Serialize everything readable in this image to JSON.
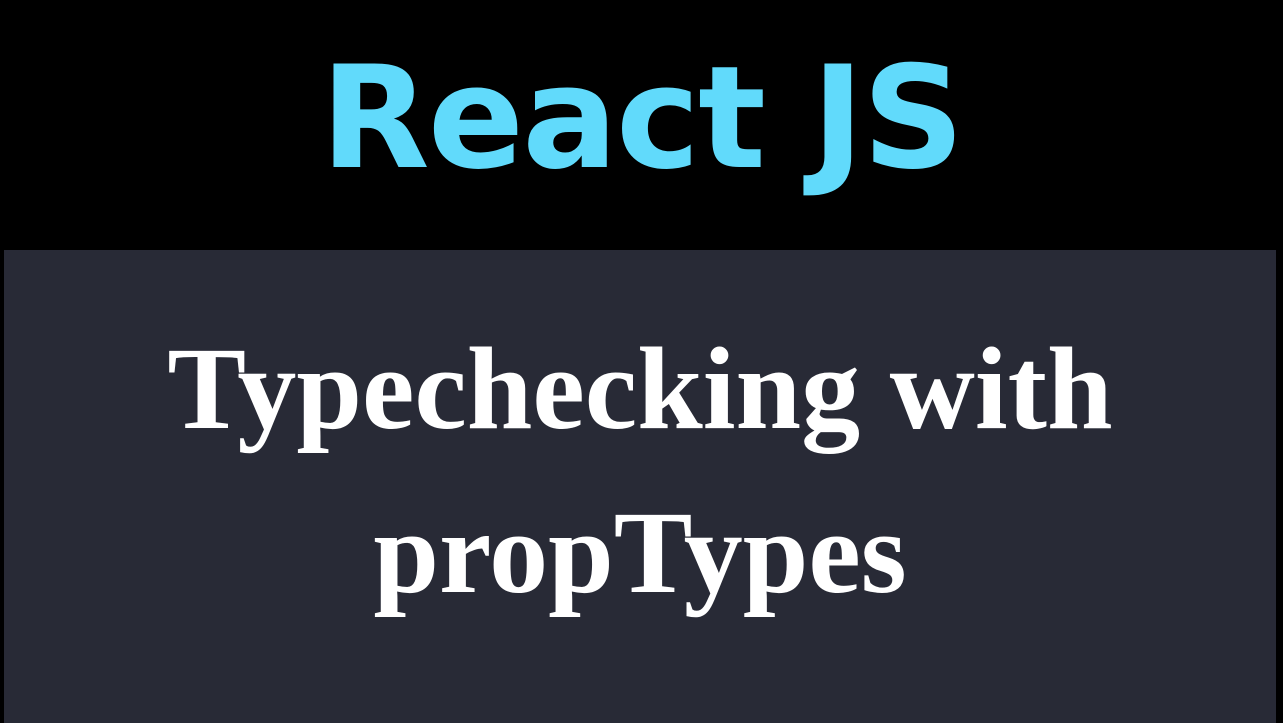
{
  "header": {
    "title": "React JS"
  },
  "main": {
    "subtitle_line_1": "Typechecking with",
    "subtitle_line_2": "propTypes"
  },
  "colors": {
    "background_top": "#000000",
    "panel_background": "#282a36",
    "title_color": "#61dafb",
    "subtitle_color": "#ffffff"
  }
}
